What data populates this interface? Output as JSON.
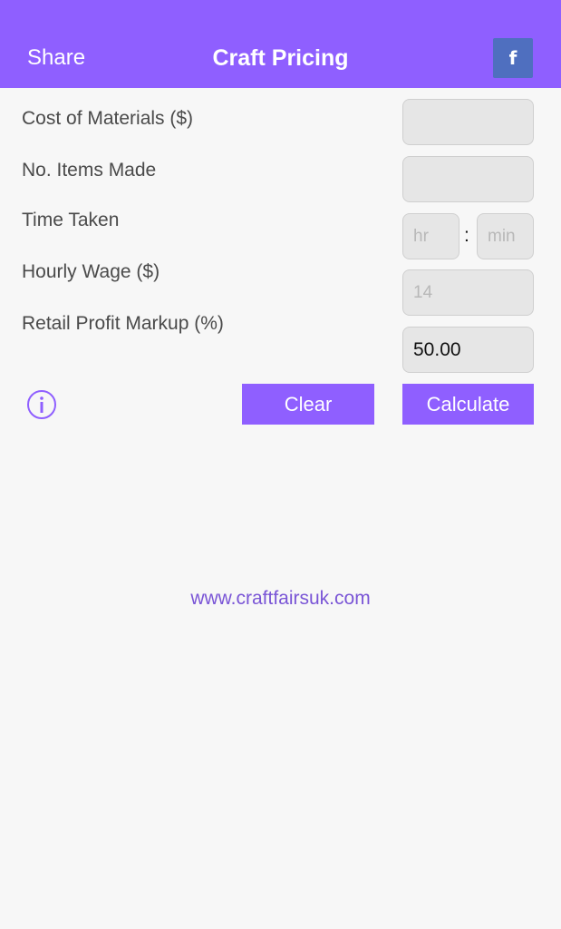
{
  "navbar": {
    "share_label": "Share",
    "title": "Craft Pricing",
    "facebook_label": "f",
    "accent_color": "#8f5fff"
  },
  "form": {
    "materials_label": "Cost of Materials ($)",
    "materials_value": "",
    "items_label": "No. Items Made",
    "items_value": "",
    "time_label": "Time Taken",
    "hours_placeholder": "hr",
    "separator": ":",
    "minutes_placeholder": "min",
    "wage_label": "Hourly Wage ($)",
    "wage_placeholder": "14",
    "markup_label": "Retail Profit Markup (%)",
    "markup_value": "50.00"
  },
  "actions": {
    "info_icon": "info-circle-icon",
    "clear_label": "Clear",
    "calculate_label": "Calculate"
  },
  "footer": {
    "link_text": "www.craftfairsuk.com"
  }
}
